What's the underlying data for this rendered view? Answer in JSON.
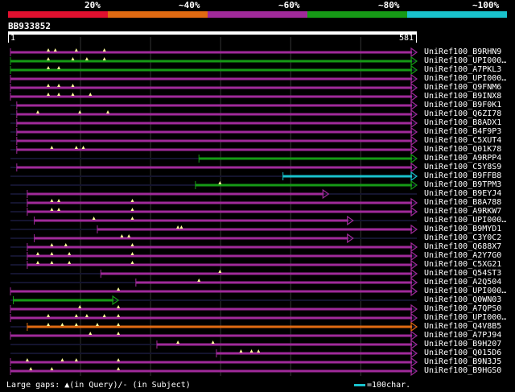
{
  "query_id": "BB933852",
  "query_start": "1",
  "query_end": "581",
  "query_length": 581,
  "legend": {
    "labels": [
      "20%",
      "~40%",
      "~60%",
      "~80%",
      "~100%"
    ],
    "colors": [
      "#e0102f",
      "#e06a12",
      "#a02a9a",
      "#169a16",
      "#19c2cc"
    ]
  },
  "footer": {
    "gaps_text": "Large gaps: ▲(in Query)/- (in Subject)",
    "scale_text": "=100char."
  },
  "rows": [
    {
      "label": "UniRef100_B9RHN9",
      "color": "#a02a9a",
      "start": 1,
      "end": 581,
      "gaps": [
        55,
        65,
        95,
        135
      ],
      "arrow": true
    },
    {
      "label": "UniRef100_UPI000…",
      "color": "#169a16",
      "start": 1,
      "end": 581,
      "gaps": [
        55,
        90,
        110,
        135
      ],
      "arrow": true
    },
    {
      "label": "UniRef100_A7PKL3",
      "color": "#169a16",
      "start": 1,
      "end": 581,
      "gaps": [
        55,
        70
      ],
      "arrow": true
    },
    {
      "label": "UniRef100_UPI000…",
      "color": "#a02a9a",
      "start": 1,
      "end": 581,
      "gaps": [],
      "arrow": true
    },
    {
      "label": "UniRef100_Q9FNM6",
      "color": "#a02a9a",
      "start": 1,
      "end": 581,
      "gaps": [
        55,
        70,
        90
      ],
      "arrow": true
    },
    {
      "label": "UniRef100_B9INX8",
      "color": "#a02a9a",
      "start": 1,
      "end": 581,
      "gaps": [
        55,
        70,
        90,
        115
      ],
      "arrow": true
    },
    {
      "label": "UniRef100_B9F0K1",
      "color": "#a02a9a",
      "start": 10,
      "end": 581,
      "gaps": [],
      "arrow": true
    },
    {
      "label": "UniRef100_Q6ZI78",
      "color": "#a02a9a",
      "start": 10,
      "end": 581,
      "gaps": [
        40,
        100,
        140
      ],
      "arrow": true
    },
    {
      "label": "UniRef100_B8ADX1",
      "color": "#a02a9a",
      "start": 10,
      "end": 581,
      "gaps": [],
      "arrow": true
    },
    {
      "label": "UniRef100_B4F9P3",
      "color": "#a02a9a",
      "start": 10,
      "end": 581,
      "gaps": [],
      "arrow": true
    },
    {
      "label": "UniRef100_C5XUT4",
      "color": "#a02a9a",
      "start": 10,
      "end": 581,
      "gaps": [],
      "arrow": true
    },
    {
      "label": "UniRef100_Q01K78",
      "color": "#a02a9a",
      "start": 10,
      "end": 581,
      "gaps": [
        60,
        95,
        105
      ],
      "arrow": true
    },
    {
      "label": "UniRef100_A9RPP4",
      "color": "#169a16",
      "start": 270,
      "end": 581,
      "gaps": [],
      "arrow": true
    },
    {
      "label": "UniRef100_C5Y8S9",
      "color": "#a02a9a",
      "start": 10,
      "end": 581,
      "gaps": [],
      "arrow": true
    },
    {
      "label": "UniRef100_B9FFB8",
      "color": "#19c2cc",
      "start": 390,
      "end": 581,
      "gaps": [],
      "arrow": true
    },
    {
      "label": "UniRef100_B9TPM3",
      "color": "#169a16",
      "start": 265,
      "end": 581,
      "gaps": [
        300
      ],
      "arrow": true
    },
    {
      "label": "UniRef100_B9EYJ4",
      "color": "#a02a9a",
      "start": 25,
      "end": 455,
      "gaps": [],
      "arrow": true
    },
    {
      "label": "UniRef100_B8A788",
      "color": "#a02a9a",
      "start": 25,
      "end": 581,
      "gaps": [
        60,
        70,
        175
      ],
      "arrow": true
    },
    {
      "label": "UniRef100_A9RKW7",
      "color": "#a02a9a",
      "start": 25,
      "end": 581,
      "gaps": [
        60,
        70,
        175
      ],
      "arrow": true
    },
    {
      "label": "UniRef100_UPI000…",
      "color": "#a02a9a",
      "start": 35,
      "end": 490,
      "gaps": [
        120,
        175
      ],
      "arrow": true
    },
    {
      "label": "UniRef100_B9MYD1",
      "color": "#a02a9a",
      "start": 125,
      "end": 581,
      "gaps": [
        240,
        245
      ],
      "arrow": true
    },
    {
      "label": "UniRef100_C3Y0C2",
      "color": "#a02a9a",
      "start": 35,
      "end": 490,
      "gaps": [
        160,
        170
      ],
      "arrow": true
    },
    {
      "label": "UniRef100_Q688X7",
      "color": "#a02a9a",
      "start": 25,
      "end": 581,
      "gaps": [
        60,
        80,
        175
      ],
      "arrow": true
    },
    {
      "label": "UniRef100_A2Y7G0",
      "color": "#a02a9a",
      "start": 25,
      "end": 581,
      "gaps": [
        40,
        60,
        85,
        175
      ],
      "arrow": true
    },
    {
      "label": "UniRef100_C5XG21",
      "color": "#a02a9a",
      "start": 25,
      "end": 581,
      "gaps": [
        40,
        60,
        85,
        175
      ],
      "arrow": true
    },
    {
      "label": "UniRef100_Q54ST3",
      "color": "#a02a9a",
      "start": 130,
      "end": 581,
      "gaps": [
        300
      ],
      "arrow": true
    },
    {
      "label": "UniRef100_A2Q504",
      "color": "#a02a9a",
      "start": 180,
      "end": 581,
      "gaps": [
        270
      ],
      "arrow": true
    },
    {
      "label": "UniRef100_UPI000…",
      "color": "#a02a9a",
      "start": 1,
      "end": 581,
      "gaps": [
        155
      ],
      "arrow": true
    },
    {
      "label": "UniRef100_Q0WN03",
      "color": "#169a16",
      "start": 5,
      "end": 155,
      "gaps": [],
      "arrow": true
    },
    {
      "label": "UniRef100_A7QPS0",
      "color": "#a02a9a",
      "start": 1,
      "end": 581,
      "gaps": [
        100,
        155
      ],
      "arrow": true
    },
    {
      "label": "UniRef100_UPI000…",
      "color": "#a02a9a",
      "start": 1,
      "end": 581,
      "gaps": [
        55,
        95,
        110,
        135,
        155
      ],
      "arrow": true
    },
    {
      "label": "UniRef100_Q4V8B5",
      "color": "#e06a12",
      "start": 25,
      "end": 581,
      "gaps": [
        55,
        75,
        95,
        125,
        155
      ],
      "arrow": true
    },
    {
      "label": "UniRef100_A7PJ94",
      "color": "#a02a9a",
      "start": 1,
      "end": 581,
      "gaps": [
        115,
        155
      ],
      "arrow": true
    },
    {
      "label": "UniRef100_B9H207",
      "color": "#a02a9a",
      "start": 210,
      "end": 581,
      "gaps": [
        240,
        290
      ],
      "arrow": true
    },
    {
      "label": "UniRef100_Q015D6",
      "color": "#a02a9a",
      "start": 295,
      "end": 581,
      "gaps": [
        330,
        345,
        355
      ],
      "arrow": true
    },
    {
      "label": "UniRef100_B9N3J5",
      "color": "#a02a9a",
      "start": 1,
      "end": 581,
      "gaps": [
        25,
        75,
        95,
        155
      ],
      "arrow": true
    },
    {
      "label": "UniRef100_B9HGS0",
      "color": "#a02a9a",
      "start": 1,
      "end": 581,
      "gaps": [
        30,
        60,
        155
      ],
      "arrow": true
    }
  ]
}
